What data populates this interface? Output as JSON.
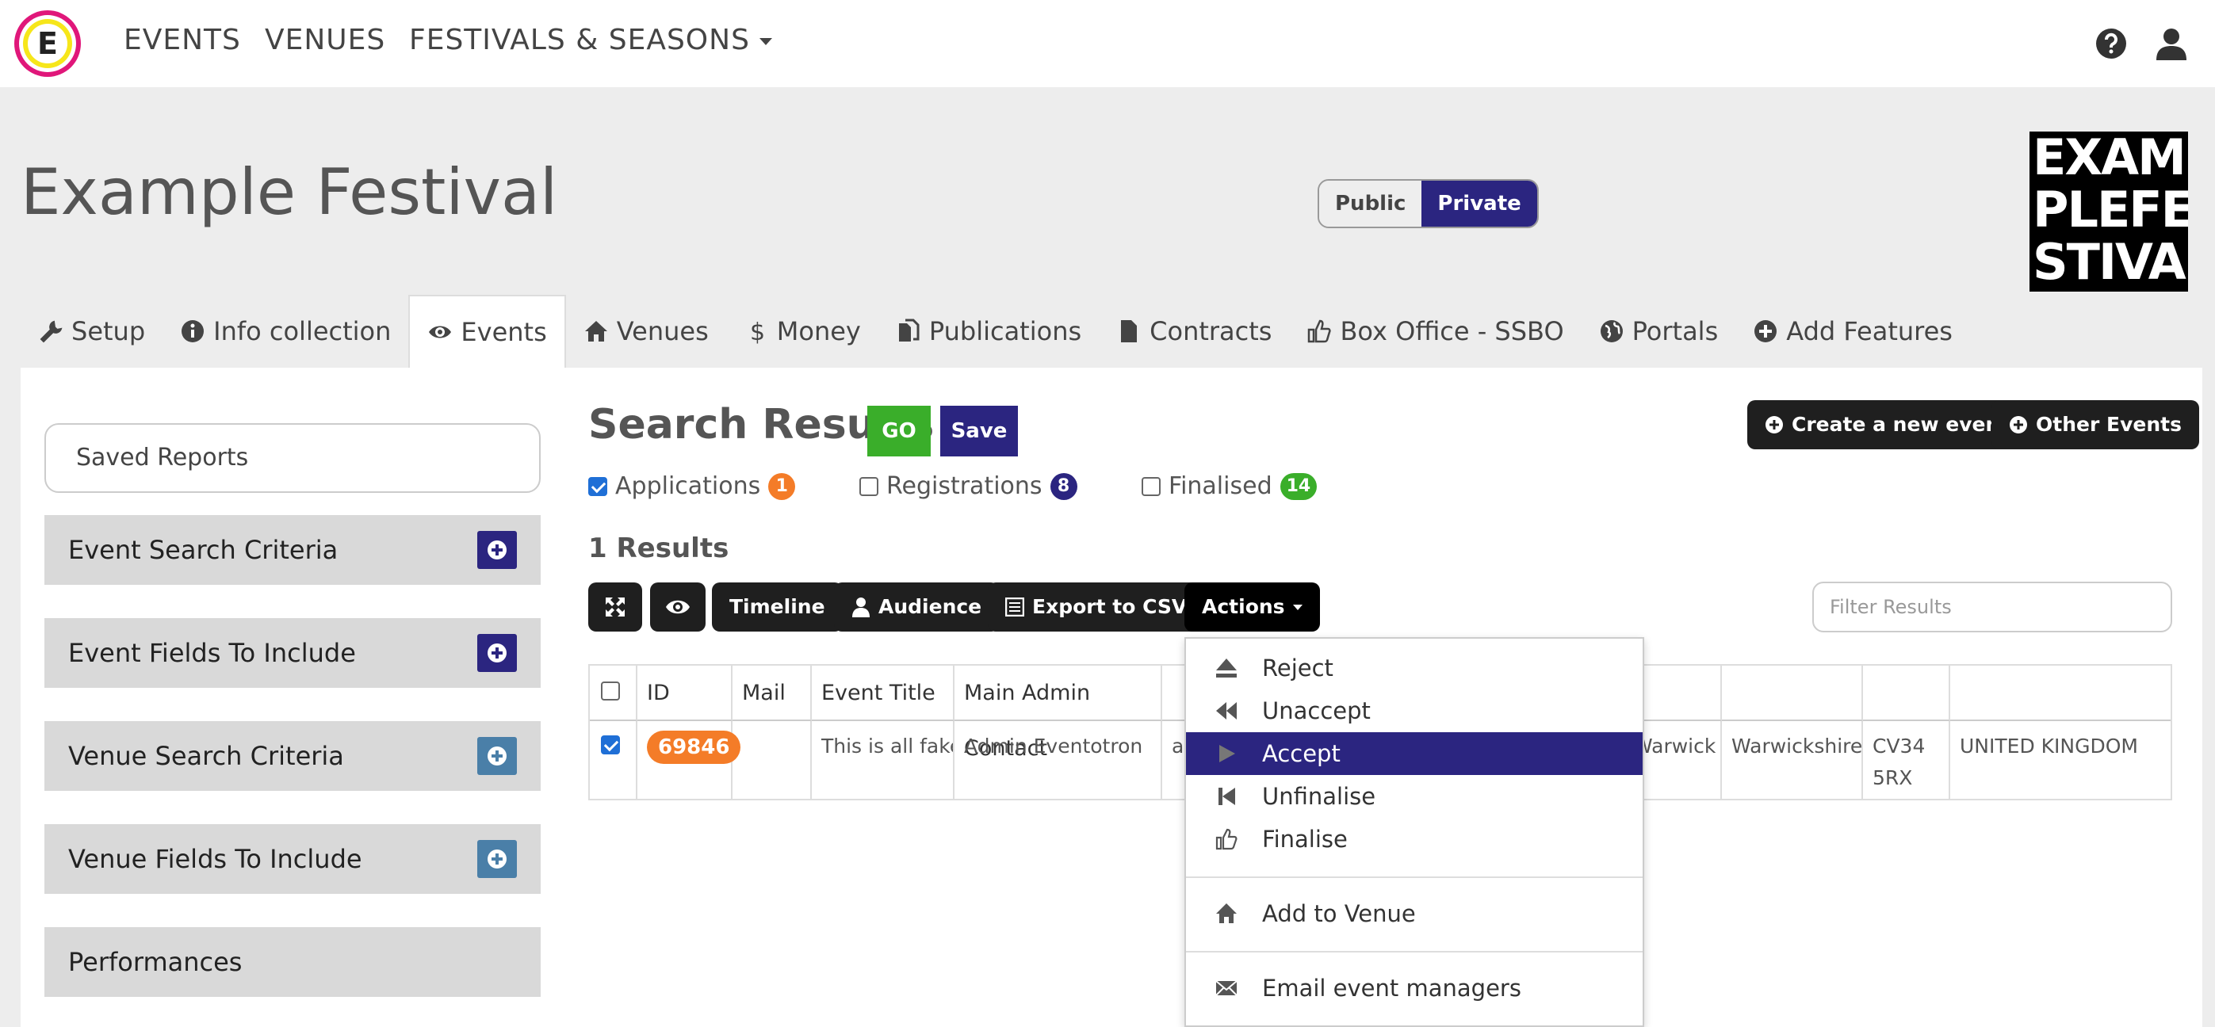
{
  "nav": {
    "logo_letter": "E",
    "links": [
      "EVENTS",
      "VENUES",
      "FESTIVALS & SEASONS"
    ],
    "icons": [
      "help-icon",
      "user-icon"
    ]
  },
  "header": {
    "title": "Example Festival",
    "toggle": {
      "public": "Public",
      "private": "Private",
      "selected": "Private"
    },
    "logo_lines": [
      "EXAM",
      "PLEFE",
      "STIVAL"
    ]
  },
  "tabs": [
    {
      "label": "Setup",
      "icon": "wrench-icon"
    },
    {
      "label": "Info collection",
      "icon": "info-icon"
    },
    {
      "label": "Events",
      "icon": "eye-icon",
      "active": true
    },
    {
      "label": "Venues",
      "icon": "home-icon"
    },
    {
      "label": "Money",
      "icon": "dollar-icon"
    },
    {
      "label": "Publications",
      "icon": "files-icon"
    },
    {
      "label": "Contracts",
      "icon": "file-icon"
    },
    {
      "label": "Box Office - SSBO",
      "icon": "thumbs-up-icon"
    },
    {
      "label": "Portals",
      "icon": "globe-icon"
    },
    {
      "label": "Add Features",
      "icon": "plus-circle-icon"
    }
  ],
  "sidebar": {
    "saved_reports": "Saved Reports",
    "sections": [
      "Event Search Criteria",
      "Event Fields To Include",
      "Venue Search Criteria",
      "Venue Fields To Include",
      "Performances"
    ]
  },
  "results": {
    "title": "Search Results",
    "go": "GO",
    "save": "Save",
    "create_event": "Create a new event",
    "other_events": "Other Events",
    "filters": [
      {
        "label": "Applications",
        "count": "1",
        "checked": true,
        "color": "#f47c28"
      },
      {
        "label": "Registrations",
        "count": "8",
        "checked": false,
        "color": "#2b2580"
      },
      {
        "label": "Finalised",
        "count": "14",
        "checked": false,
        "color": "#3aae2a"
      }
    ],
    "count_label": "1 Results",
    "toolbar": {
      "timeline": "Timeline",
      "audience": "Audience",
      "export": "Export to CSV",
      "actions": "Actions"
    },
    "filter_placeholder": "Filter Results"
  },
  "table": {
    "headers": [
      "ID",
      "Mail",
      "Event Title",
      "Main Admin Contact"
    ],
    "row": {
      "id": "69846",
      "title": "This is all fake",
      "contact": "Admin Eventotron",
      "email_fragment": "ac",
      "city": "Warwick",
      "county": "Warwickshire",
      "postcode": "CV34 5RX",
      "country": "UNITED KINGDOM"
    }
  },
  "dropdown": {
    "items": [
      "Reject",
      "Unaccept",
      "Accept",
      "Unfinalise",
      "Finalise"
    ],
    "active": "Accept",
    "add_to_venue": "Add to Venue",
    "email": "Email event managers"
  }
}
